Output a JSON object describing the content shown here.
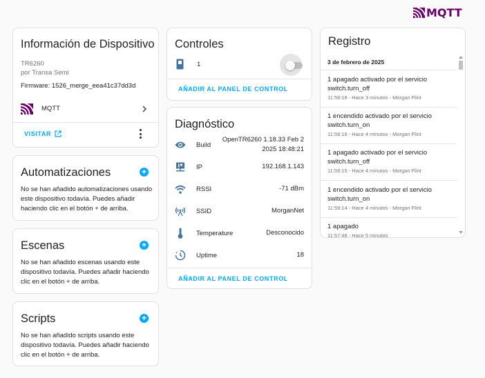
{
  "header": {
    "logo_text": "MQTT"
  },
  "device_info": {
    "title": "Información de Dispositivo",
    "model": "TR6260",
    "manufacturer": "por Transa Semi",
    "firmware": "Firmware: 1526_merge_eea41c37dd3d",
    "integration_label": "MQTT",
    "visit_label": "VISITAR"
  },
  "automations": {
    "title": "Automatizaciones",
    "empty_text": "No se han añadido automatizaciones usando este dispositivo todavía. Puedes añadir haciendo clic en el botón + de arriba."
  },
  "scenes": {
    "title": "Escenas",
    "empty_text": "No se han añadido escenas usando este dispositivo todavía. Puedes añadir haciendo clic en el botón + de arriba."
  },
  "scripts": {
    "title": "Scripts",
    "empty_text": "No se han añadido scripts usando este dispositivo todavía. Puedes añadir haciendo clic en el botón + de arriba."
  },
  "controls": {
    "title": "Controles",
    "entity_name": "1",
    "switch_state": "off",
    "add_label": "AÑADIR AL PANEL DE CONTROL"
  },
  "diagnostics": {
    "title": "Diagnóstico",
    "rows": [
      {
        "icon": "eye-icon",
        "label": "Build",
        "value": "OpenTR6260 1.18.33 Feb 2 2025 18:48:21"
      },
      {
        "icon": "ip-network-icon",
        "label": "IP",
        "value": "192.168.1.143"
      },
      {
        "icon": "wifi-icon",
        "label": "RSSI",
        "value": "-71 dBm"
      },
      {
        "icon": "access-point-icon",
        "label": "SSID",
        "value": "MorganNet"
      },
      {
        "icon": "thermometer-icon",
        "label": "Temperature",
        "value": "Desconocido"
      },
      {
        "icon": "timer-icon",
        "label": "Uptime",
        "value": "18"
      }
    ],
    "add_label": "AÑADIR AL PANEL DE CONTROL"
  },
  "logbook": {
    "title": "Registro",
    "date": "3 de febrero de 2025",
    "entries": [
      {
        "text": "1 apagado activado por el servicio switch.turn_off",
        "meta": "11:59:18 - Hace 3 minutos - Morgan Flint"
      },
      {
        "text": "1 encendido activado por el servicio switch.turn_on",
        "meta": "11:59:16 - Hace 4 minutos - Morgan Flint"
      },
      {
        "text": "1 apagado activado por el servicio switch.turn_off",
        "meta": "11:59:15 - Hace 4 minutos - Morgan Flint"
      },
      {
        "text": "1 encendido activado por el servicio switch.turn_on",
        "meta": "11:59:14 - Hace 4 minutos - Morgan Flint"
      },
      {
        "text": "1 apagado",
        "meta": "11:57:48 - Hace 5 minutos"
      }
    ]
  },
  "colors": {
    "accent": "#03a9f4",
    "mqtt_brand": "#660066",
    "icon": "#44739e"
  }
}
